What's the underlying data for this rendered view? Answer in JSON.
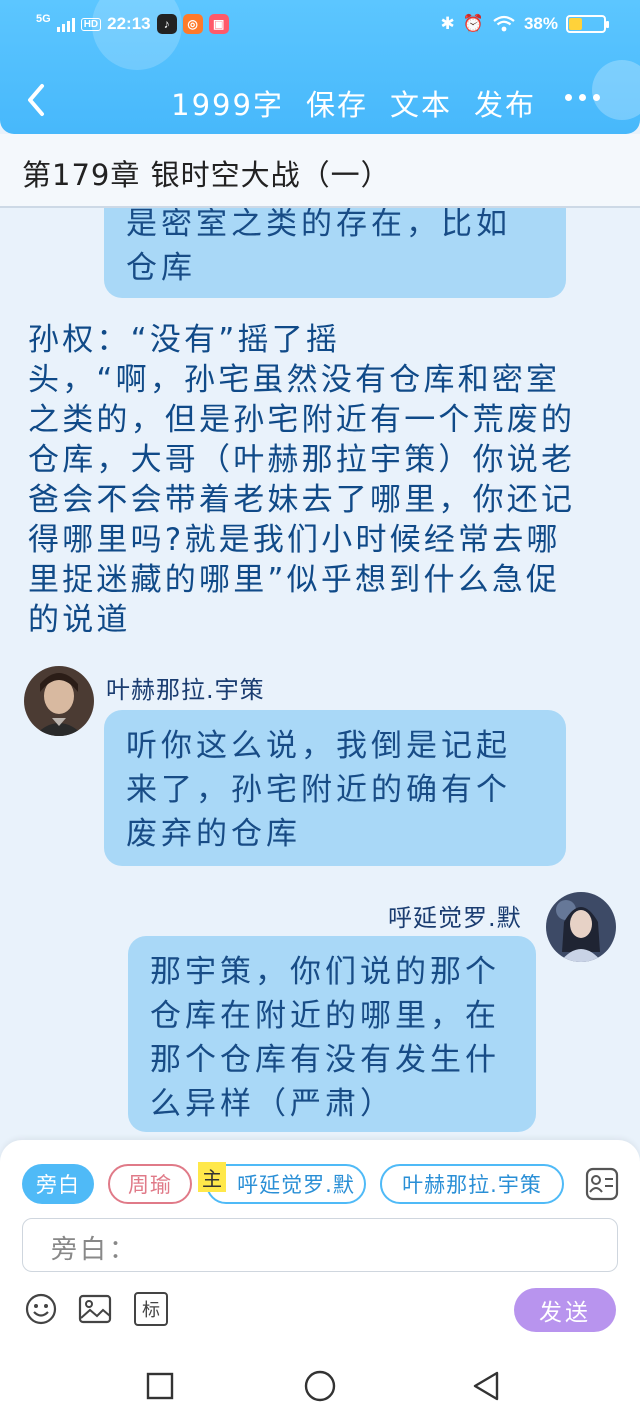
{
  "status_bar": {
    "network": "5G",
    "hd": "HD",
    "time": "22:13",
    "battery": "38%",
    "battery_level": 0.38,
    "icons": [
      "tiktok-icon",
      "app-icon-orange",
      "app-icon-red",
      "bluetooth-icon",
      "alarm-icon",
      "wifi-icon"
    ]
  },
  "header": {
    "word_count": "1999字",
    "save": "保存",
    "text": "文本",
    "publish": "发布"
  },
  "chapter_title": "第179章 银时空大战（一）",
  "chat": {
    "bubble_top": "是密室之类的存在，比如\n仓库",
    "narration": "    孙权：“没有”摇了摇\n头，“啊，孙宅虽然没有仓库和密室\n之类的，但是孙宅附近有一个荒废的\n仓库，大哥（叶赫那拉宇策）你说老\n爸会不会带着老妹去了哪里，你还记\n得哪里吗?就是我们小时候经常去哪\n里捉迷藏的哪里”似乎想到什么急促\n的说道",
    "msg1": {
      "name": "叶赫那拉.宇策",
      "text": "听你这么说，我倒是记起\n来了，孙宅附近的确有个\n废弃的仓库"
    },
    "msg2": {
      "name": "呼延觉罗.默",
      "text": "那宇策，你们说的那个\n仓库在附近的哪里，在\n那个仓库有没有发生什\n么异样（严肃）"
    }
  },
  "input_panel": {
    "roles": [
      "旁白",
      "周瑜",
      "呼延觉罗.默",
      "叶赫那拉.宇策"
    ],
    "main_badge": "主",
    "placeholder": "旁白：",
    "mark_button": "标",
    "send": "发送"
  },
  "colors": {
    "header": "#47b8fb",
    "bubble": "#a9d8f7",
    "send": "#b894ee",
    "role_active": "#4fbaf7",
    "role_zhouyu": "#e07a88"
  }
}
